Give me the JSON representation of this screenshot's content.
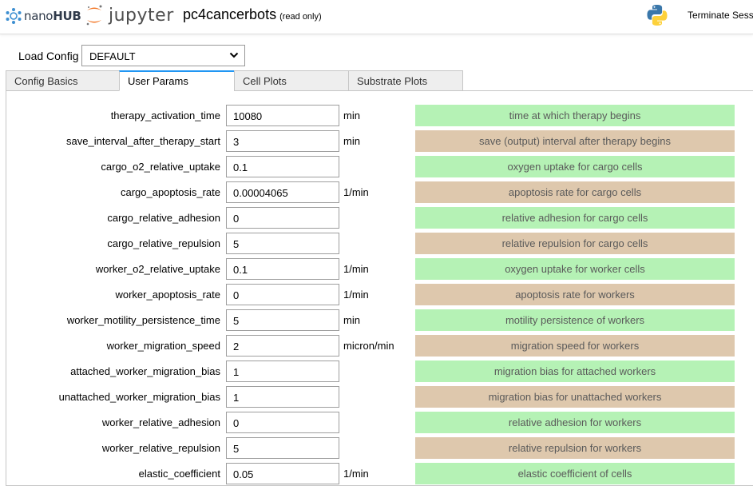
{
  "header": {
    "nanohub_text_light": "nano",
    "nanohub_text_bold": "HUB",
    "jupyter_text": "jupyter",
    "notebook_title": "pc4cancerbots",
    "read_only": "(read only)",
    "terminate_label": "Terminate Sess"
  },
  "load_config": {
    "label": "Load Config",
    "value": "DEFAULT"
  },
  "tabs": [
    {
      "label": "Config Basics",
      "active": false
    },
    {
      "label": "User Params",
      "active": true
    },
    {
      "label": "Cell Plots",
      "active": false
    },
    {
      "label": "Substrate Plots",
      "active": false
    }
  ],
  "params": [
    {
      "name": "therapy_activation_time",
      "value": "10080",
      "unit": "min",
      "desc": "time at which therapy begins",
      "color": "green"
    },
    {
      "name": "save_interval_after_therapy_start",
      "value": "3",
      "unit": "min",
      "desc": "save (output) interval after therapy begins",
      "color": "tan"
    },
    {
      "name": "cargo_o2_relative_uptake",
      "value": "0.1",
      "unit": "",
      "desc": "oxygen uptake for cargo cells",
      "color": "green"
    },
    {
      "name": "cargo_apoptosis_rate",
      "value": "0.00004065",
      "unit": "1/min",
      "desc": "apoptosis rate for cargo cells",
      "color": "tan"
    },
    {
      "name": "cargo_relative_adhesion",
      "value": "0",
      "unit": "",
      "desc": "relative adhesion for cargo cells",
      "color": "green"
    },
    {
      "name": "cargo_relative_repulsion",
      "value": "5",
      "unit": "",
      "desc": "relative repulsion for cargo cells",
      "color": "tan"
    },
    {
      "name": "worker_o2_relative_uptake",
      "value": "0.1",
      "unit": "1/min",
      "desc": "oxygen uptake for worker cells",
      "color": "green"
    },
    {
      "name": "worker_apoptosis_rate",
      "value": "0",
      "unit": "1/min",
      "desc": "apoptosis rate for workers",
      "color": "tan"
    },
    {
      "name": "worker_motility_persistence_time",
      "value": "5",
      "unit": "min",
      "desc": "motility persistence of workers",
      "color": "green"
    },
    {
      "name": "worker_migration_speed",
      "value": "2",
      "unit": "micron/min",
      "desc": "migration speed for workers",
      "color": "tan"
    },
    {
      "name": "attached_worker_migration_bias",
      "value": "1",
      "unit": "",
      "desc": "migration bias for attached workers",
      "color": "green"
    },
    {
      "name": "unattached_worker_migration_bias",
      "value": "1",
      "unit": "",
      "desc": "migration bias for unattached workers",
      "color": "tan"
    },
    {
      "name": "worker_relative_adhesion",
      "value": "0",
      "unit": "",
      "desc": "relative adhesion for workers",
      "color": "green"
    },
    {
      "name": "worker_relative_repulsion",
      "value": "5",
      "unit": "",
      "desc": "relative repulsion for workers",
      "color": "tan"
    },
    {
      "name": "elastic_coefficient",
      "value": "0.05",
      "unit": "1/min",
      "desc": "elastic coefficient of cells",
      "color": "green"
    }
  ],
  "colors": {
    "green": "#b5f2b5",
    "tan": "#dec8ad",
    "tab_accent": "#2196f3"
  },
  "icons": {
    "logo_nanohub": "nanohub-logo",
    "logo_jupyter": "jupyter-logo",
    "logo_python": "python-logo",
    "dropdown": "chevron-down-icon"
  }
}
